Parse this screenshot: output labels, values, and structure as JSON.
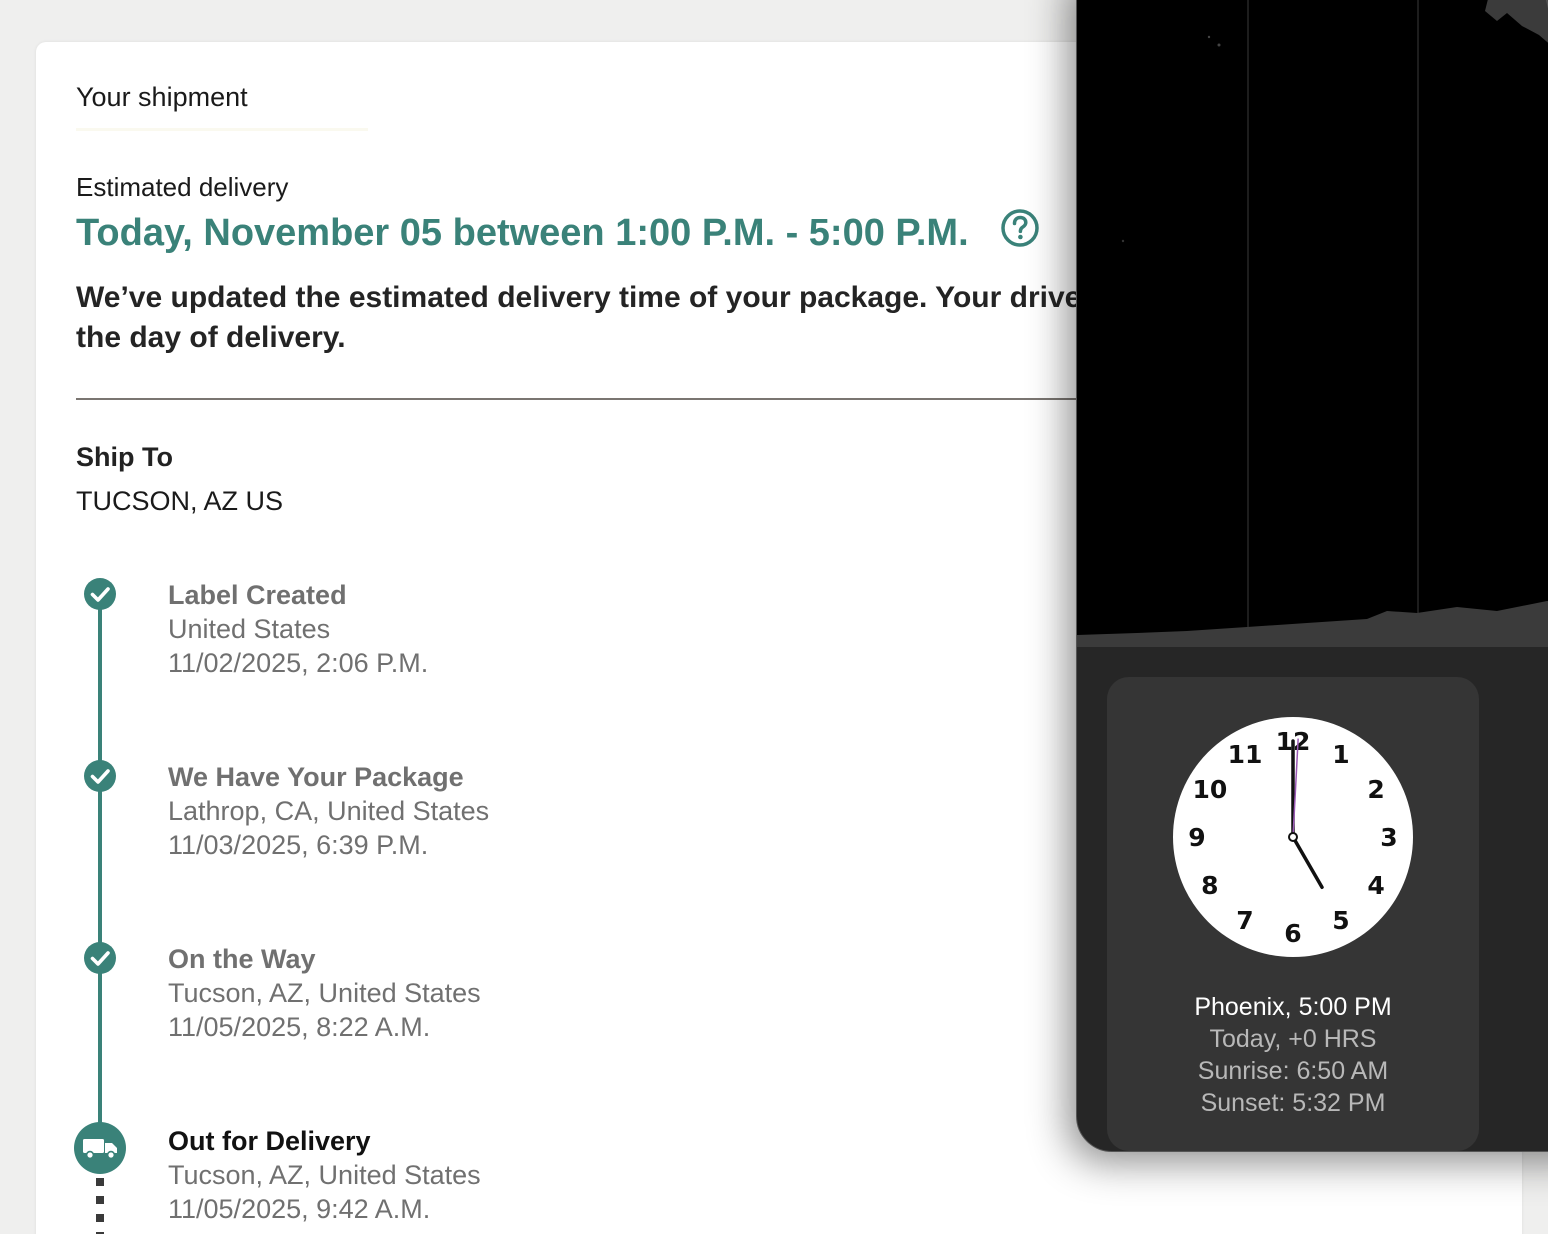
{
  "shipment": {
    "title": "Your shipment",
    "estimated_label": "Estimated delivery",
    "estimated_value": "Today, November 05 between 1:00 P.M. - 5:00 P.M.",
    "notice": "We’ve updated the estimated delivery time of your package. Your driver will provide an update on the day of delivery.",
    "ship_to_label": "Ship To",
    "ship_to_value": "TUCSON, AZ US"
  },
  "timeline": [
    {
      "title": "Label Created",
      "location": "United States",
      "datetime": "11/02/2025, 2:06 P.M.",
      "status": "complete"
    },
    {
      "title": "We Have Your Package",
      "location": "Lathrop, CA, United States",
      "datetime": "11/03/2025, 6:39 P.M.",
      "status": "complete"
    },
    {
      "title": "On the Way",
      "location": "Tucson, AZ, United States",
      "datetime": "11/05/2025, 8:22 A.M.",
      "status": "complete"
    },
    {
      "title": "Out for Delivery",
      "location": "Tucson, AZ, United States",
      "datetime": "11/05/2025, 9:42 A.M.",
      "status": "current"
    }
  ],
  "icons": {
    "help": "question-circle-icon",
    "check": "check-circle-icon",
    "truck": "truck-icon"
  },
  "colors": {
    "accent": "#3a8279",
    "clock_bg": "#262626"
  },
  "clock": {
    "city_time": "Phoenix, 5:00 PM",
    "offset": "Today, +0 HRS",
    "sunrise": "Sunrise: 6:50 AM",
    "sunset": "Sunset: 5:32 PM",
    "hour": 5,
    "minute": 0,
    "second": 0,
    "numerals": [
      "12",
      "1",
      "2",
      "3",
      "4",
      "5",
      "6",
      "7",
      "8",
      "9",
      "10",
      "11"
    ]
  }
}
